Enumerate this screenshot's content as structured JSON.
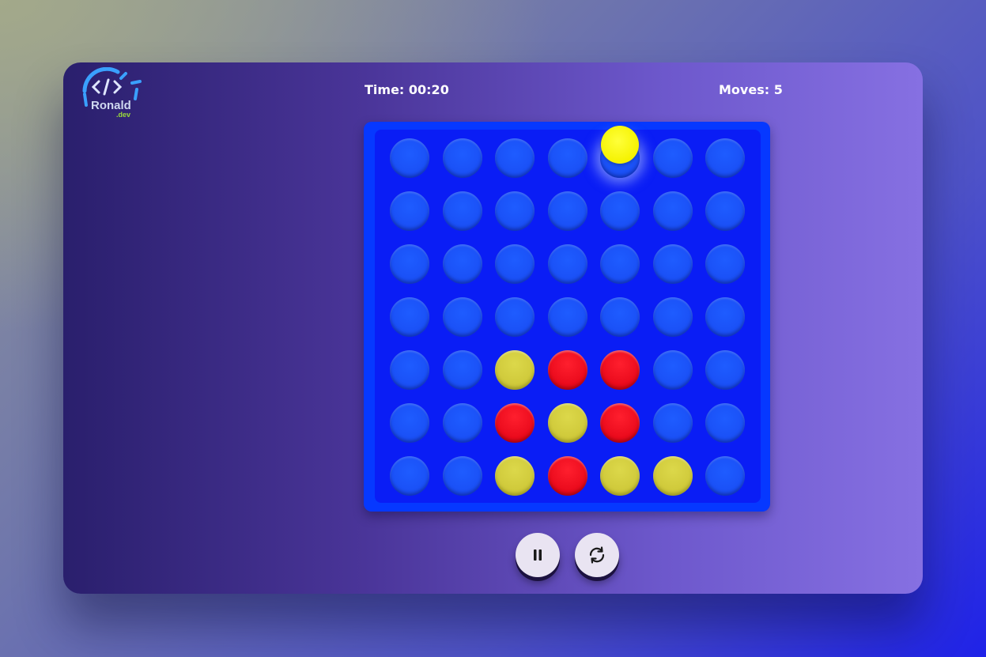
{
  "logo": {
    "text": "Ronald",
    "suffix": ".dev",
    "icon": "code-brackets-logo-icon"
  },
  "hud": {
    "time_label": "Time: 00:20",
    "moves_label": "Moves: 5"
  },
  "board": {
    "columns": 7,
    "rows": 7,
    "hover_column": 4,
    "hover_color": "yellow",
    "cells": [
      [
        "empty",
        "empty",
        "empty",
        "empty",
        "empty",
        "empty",
        "empty"
      ],
      [
        "empty",
        "empty",
        "empty",
        "empty",
        "empty",
        "empty",
        "empty"
      ],
      [
        "empty",
        "empty",
        "empty",
        "empty",
        "empty",
        "empty",
        "empty"
      ],
      [
        "empty",
        "empty",
        "empty",
        "empty",
        "empty",
        "empty",
        "empty"
      ],
      [
        "empty",
        "empty",
        "yellow",
        "red",
        "red",
        "empty",
        "empty"
      ],
      [
        "empty",
        "empty",
        "red",
        "yellow",
        "red",
        "empty",
        "empty"
      ],
      [
        "empty",
        "empty",
        "yellow",
        "red",
        "yellow",
        "yellow",
        "empty"
      ]
    ]
  },
  "controls": {
    "pause_icon": "pause-icon",
    "restart_icon": "restart-icon"
  },
  "colors": {
    "board": "#0638ff",
    "red": "#ea0a1c",
    "yellow": "#cfc93a",
    "hover_yellow": "#f5f200"
  }
}
